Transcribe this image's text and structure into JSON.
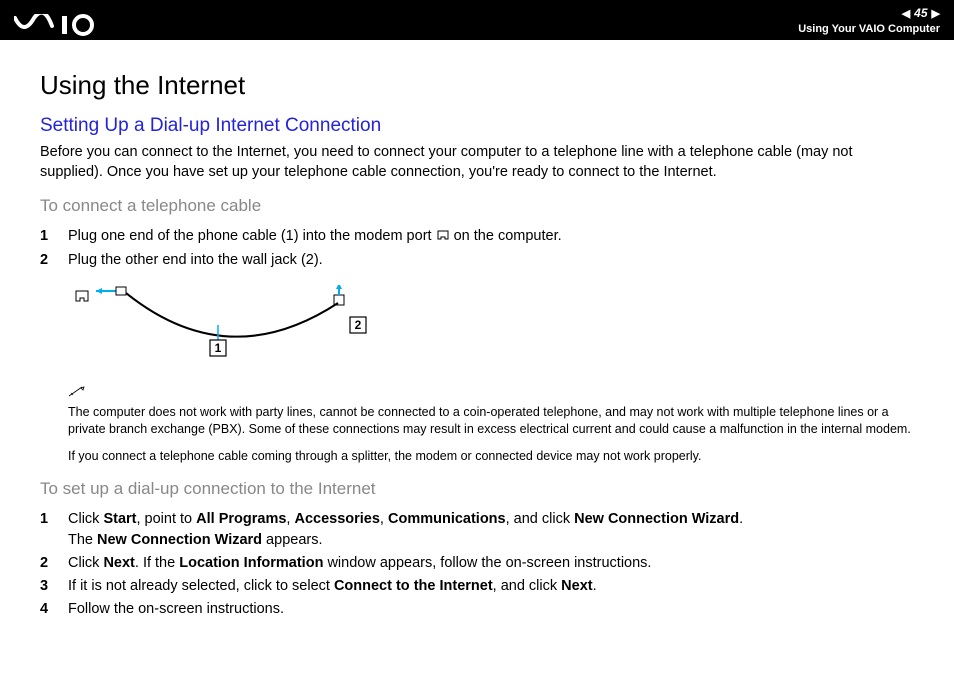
{
  "header": {
    "page_number": "45",
    "breadcrumb": "Using Your VAIO Computer"
  },
  "title": "Using the Internet",
  "section": {
    "heading": "Setting Up a Dial-up Internet Connection",
    "intro": "Before you can connect to the Internet, you need to connect your computer to a telephone line with a telephone cable (may not supplied). Once you have set up your telephone cable connection, you're ready to connect to the Internet."
  },
  "sub1": {
    "heading": "To connect a telephone cable",
    "steps": [
      {
        "pre": "Plug one end of the phone cable (1) into the modem port ",
        "post": " on the computer."
      },
      {
        "pre": "Plug the other end into the wall jack (2).",
        "post": ""
      }
    ]
  },
  "diagram": {
    "label1": "1",
    "label2": "2"
  },
  "notes": [
    "The computer does not work with party lines, cannot be connected to a coin-operated telephone, and may not work with multiple telephone lines or a private branch exchange (PBX). Some of these connections may result in excess electrical current and could cause a malfunction in the internal modem.",
    "If you connect a telephone cable coming through a splitter, the modem or connected device may not work properly."
  ],
  "sub2": {
    "heading": "To set up a dial-up connection to the Internet",
    "steps": [
      {
        "parts": [
          "Click ",
          "Start",
          ", point to ",
          "All Programs",
          ", ",
          "Accessories",
          ", ",
          "Communications",
          ", and click ",
          "New Connection Wizard",
          "."
        ],
        "line2_parts": [
          "The ",
          "New Connection Wizard",
          " appears."
        ]
      },
      {
        "parts": [
          "Click ",
          "Next",
          ". If the ",
          "Location Information",
          " window appears, follow the on-screen instructions."
        ]
      },
      {
        "parts": [
          "If it is not already selected, click to select ",
          "Connect to the Internet",
          ", and click ",
          "Next",
          "."
        ]
      },
      {
        "parts": [
          "Follow the on-screen instructions."
        ]
      }
    ]
  }
}
